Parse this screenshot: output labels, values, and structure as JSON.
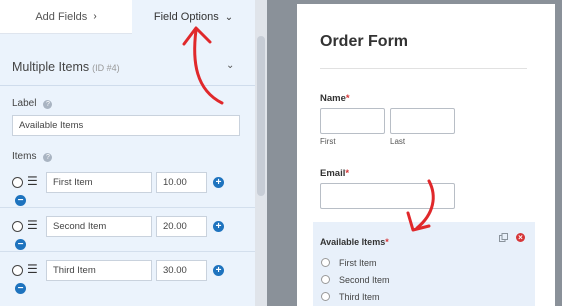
{
  "tabs": {
    "add_fields": "Add Fields",
    "field_options": "Field Options"
  },
  "panel": {
    "section_title": "Multiple Items",
    "section_id": "(ID #4)",
    "label_heading": "Label",
    "label_value": "Available Items",
    "items_heading": "Items",
    "items": [
      {
        "name": "First Item",
        "price": "10.00"
      },
      {
        "name": "Second Item",
        "price": "20.00"
      },
      {
        "name": "Third Item",
        "price": "30.00"
      }
    ]
  },
  "preview": {
    "title": "Order Form",
    "name_label": "Name",
    "first_sublabel": "First",
    "last_sublabel": "Last",
    "email_label": "Email",
    "items_label": "Available Items",
    "required_mark": "*",
    "choices": [
      "First Item",
      "Second Item",
      "Third Item"
    ]
  },
  "colors": {
    "accent_blue": "#1e73be",
    "required_red": "#d63638",
    "annotation_red": "#e0282b",
    "panel_bg": "#ebf3fc"
  },
  "icons": {
    "tab_add_chevron": "chevron-right-icon",
    "tab_options_chevron": "chevron-down-icon",
    "help": "question-circle-icon",
    "drag": "drag-handle-icon",
    "add": "plus-circle-icon",
    "remove": "minus-circle-icon",
    "duplicate": "copy-icon",
    "delete": "close-circle-icon"
  }
}
